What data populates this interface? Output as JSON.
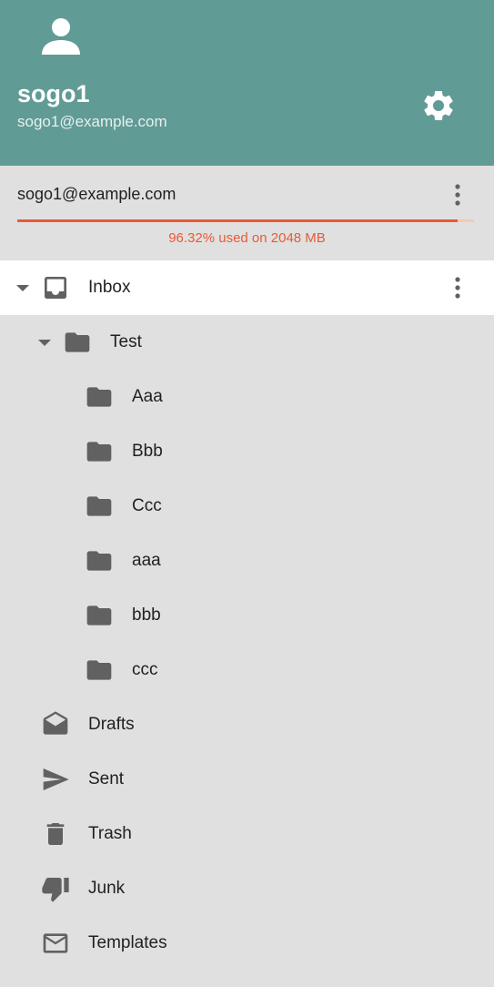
{
  "header": {
    "user_name": "sogo1",
    "user_email": "sogo1@example.com"
  },
  "account": {
    "email": "sogo1@example.com",
    "quota_text": "96.32% used on 2048 MB",
    "quota_percent": 96.32
  },
  "folders": {
    "inbox": "Inbox",
    "test": "Test",
    "sub": [
      "Aaa",
      "Bbb",
      "Ccc",
      "aaa",
      "bbb",
      "ccc"
    ],
    "drafts": "Drafts",
    "sent": "Sent",
    "trash": "Trash",
    "junk": "Junk",
    "templates": "Templates"
  },
  "colors": {
    "header": "#619b96",
    "accent": "#e95a34",
    "background": "#e0e0e0",
    "icon": "#616161"
  },
  "icons": [
    "person-icon",
    "gear-icon",
    "more-vert-icon",
    "inbox-icon",
    "folder-icon",
    "drafts-icon",
    "send-icon",
    "trash-icon",
    "thumb-down-icon",
    "mail-icon",
    "caret-down-icon"
  ]
}
